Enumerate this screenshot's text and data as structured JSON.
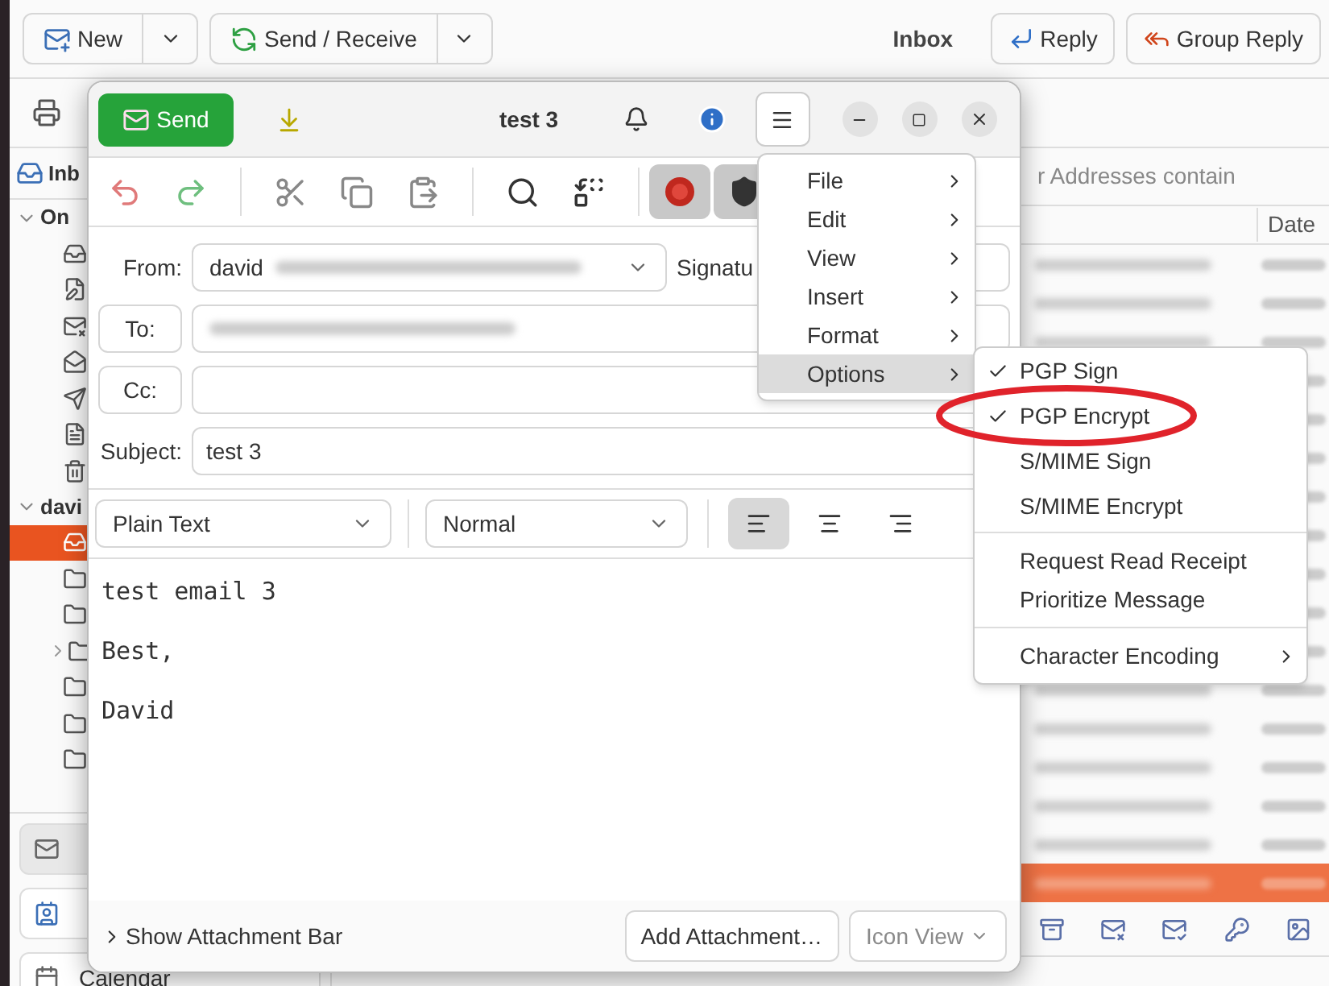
{
  "main_window": {
    "toolbar": [
      {
        "label": "New",
        "kind": "new"
      },
      {
        "label": "Send / Receive",
        "kind": "send_receive"
      }
    ],
    "folder_title": "Inbox",
    "reply_buttons": [
      {
        "label": "Reply",
        "kind": "reply"
      },
      {
        "label": "Group Reply",
        "kind": "group_reply"
      }
    ],
    "sidebar": {
      "header": "Inb",
      "accounts": [
        {
          "label": "On",
          "expanded": true,
          "folders": [
            {
              "kind": "inbox",
              "selected": false,
              "expander": false
            },
            {
              "kind": "drafts",
              "selected": false,
              "expander": false
            },
            {
              "kind": "junk",
              "selected": false,
              "expander": false
            },
            {
              "kind": "outbox",
              "selected": false,
              "expander": false
            },
            {
              "kind": "sent",
              "selected": false,
              "expander": false
            },
            {
              "kind": "templates",
              "selected": false,
              "expander": false
            },
            {
              "kind": "trash",
              "selected": false,
              "expander": false
            }
          ]
        },
        {
          "label": "davi",
          "expanded": true,
          "folders": [
            {
              "kind": "inbox",
              "selected": true,
              "expander": false
            },
            {
              "kind": "folder",
              "selected": false,
              "expander": false
            },
            {
              "kind": "folder",
              "selected": false,
              "expander": false
            },
            {
              "kind": "folder",
              "selected": false,
              "expander": true
            },
            {
              "kind": "folder",
              "selected": false,
              "expander": false
            },
            {
              "kind": "folder",
              "selected": false,
              "expander": false
            },
            {
              "kind": "folder",
              "selected": false,
              "expander": false
            }
          ]
        }
      ],
      "switcher": [
        {
          "kind": "mail",
          "selected": true
        },
        {
          "kind": "contacts",
          "selected": false
        },
        {
          "label": "Calendar",
          "kind": "calendar",
          "selected": false
        }
      ]
    },
    "search_text": "r Addresses contain",
    "columns": [
      "Date"
    ],
    "rows": [
      {
        "selected": false
      },
      {
        "selected": false
      },
      {
        "selected": false
      },
      {
        "selected": false
      },
      {
        "selected": false
      },
      {
        "selected": false
      },
      {
        "selected": false
      },
      {
        "selected": false
      },
      {
        "selected": false
      },
      {
        "selected": false
      },
      {
        "selected": false
      },
      {
        "selected": false
      },
      {
        "selected": false
      },
      {
        "selected": false
      },
      {
        "selected": false
      },
      {
        "selected": false
      },
      {
        "selected": true
      }
    ],
    "action_icons": [
      {
        "kind": "archive"
      },
      {
        "kind": "junk"
      },
      {
        "kind": "not_junk"
      },
      {
        "kind": "key"
      },
      {
        "kind": "image"
      }
    ]
  },
  "compose": {
    "title": "test 3",
    "send": "Send",
    "edit_tools": [
      {
        "kind": "undo"
      },
      {
        "kind": "redo"
      },
      {
        "kind": "cut"
      },
      {
        "kind": "copy"
      },
      {
        "kind": "paste"
      },
      {
        "kind": "find"
      },
      {
        "kind": "replace"
      }
    ],
    "security_toggles": [
      {
        "kind": "pgp_sign",
        "on": true
      },
      {
        "kind": "pgp_encrypt",
        "on": true
      }
    ],
    "from": {
      "label": "From:",
      "value": "david"
    },
    "signature": {
      "label": "Signatu"
    },
    "to": {
      "label": "To:"
    },
    "cc": {
      "label": "Cc:"
    },
    "subject": {
      "label": "Subject:",
      "value": "test 3"
    },
    "format": {
      "mode": "Plain Text",
      "paragraph": "Normal",
      "alignment": [
        {
          "kind": "left",
          "selected": true
        },
        {
          "kind": "center",
          "selected": false
        },
        {
          "kind": "right",
          "selected": false
        }
      ]
    },
    "body": [
      "test email 3",
      "Best,",
      "David"
    ],
    "attachment_bar": "Show Attachment Bar",
    "add_attachment": "Add Attachment…",
    "view_mode": {
      "label": "Icon View",
      "disabled": true
    }
  },
  "menu": {
    "items": [
      {
        "label": "File",
        "selected": false
      },
      {
        "label": "Edit",
        "selected": false
      },
      {
        "label": "View",
        "selected": false
      },
      {
        "label": "Insert",
        "selected": false
      },
      {
        "label": "Format",
        "selected": false
      },
      {
        "label": "Options",
        "selected": true
      }
    ]
  },
  "submenu": {
    "sections": [
      [
        {
          "label": "PGP Sign",
          "kind": "check",
          "checked": true
        },
        {
          "label": "PGP Encrypt",
          "kind": "check",
          "checked": true
        },
        {
          "label": "S/MIME Sign",
          "kind": "check",
          "checked": false
        },
        {
          "label": "S/MIME Encrypt",
          "kind": "check",
          "checked": false
        }
      ],
      [
        {
          "label": "Request Read Receipt",
          "kind": "check",
          "checked": false
        },
        {
          "label": "Prioritize Message",
          "kind": "check",
          "checked": false
        }
      ],
      [
        {
          "label": "Character Encoding",
          "kind": "submenu",
          "checked": false
        }
      ]
    ]
  },
  "annotation": {
    "kind": "ellipse"
  }
}
